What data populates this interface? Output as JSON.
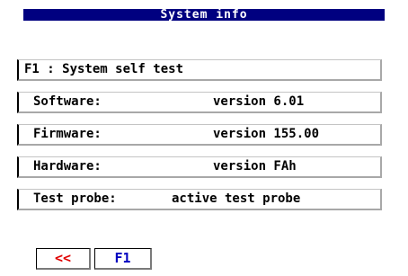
{
  "window": {
    "title": "System info"
  },
  "fields": {
    "self_test": {
      "label": "F1 : System self test"
    },
    "software": {
      "label": "Software:",
      "value": "version 6.01"
    },
    "firmware": {
      "label": "Firmware:",
      "value": "version 155.00"
    },
    "hardware": {
      "label": "Hardware:",
      "value": "version FAh"
    },
    "test_probe": {
      "label": "Test probe:",
      "value": "active test probe"
    }
  },
  "buttons": {
    "back_label": "<<",
    "f1_label": "F1"
  },
  "colors": {
    "title_background": "#000080",
    "title_text": "#ffffff",
    "back_button_text": "#e00000",
    "f1_button_text": "#0000c0"
  }
}
